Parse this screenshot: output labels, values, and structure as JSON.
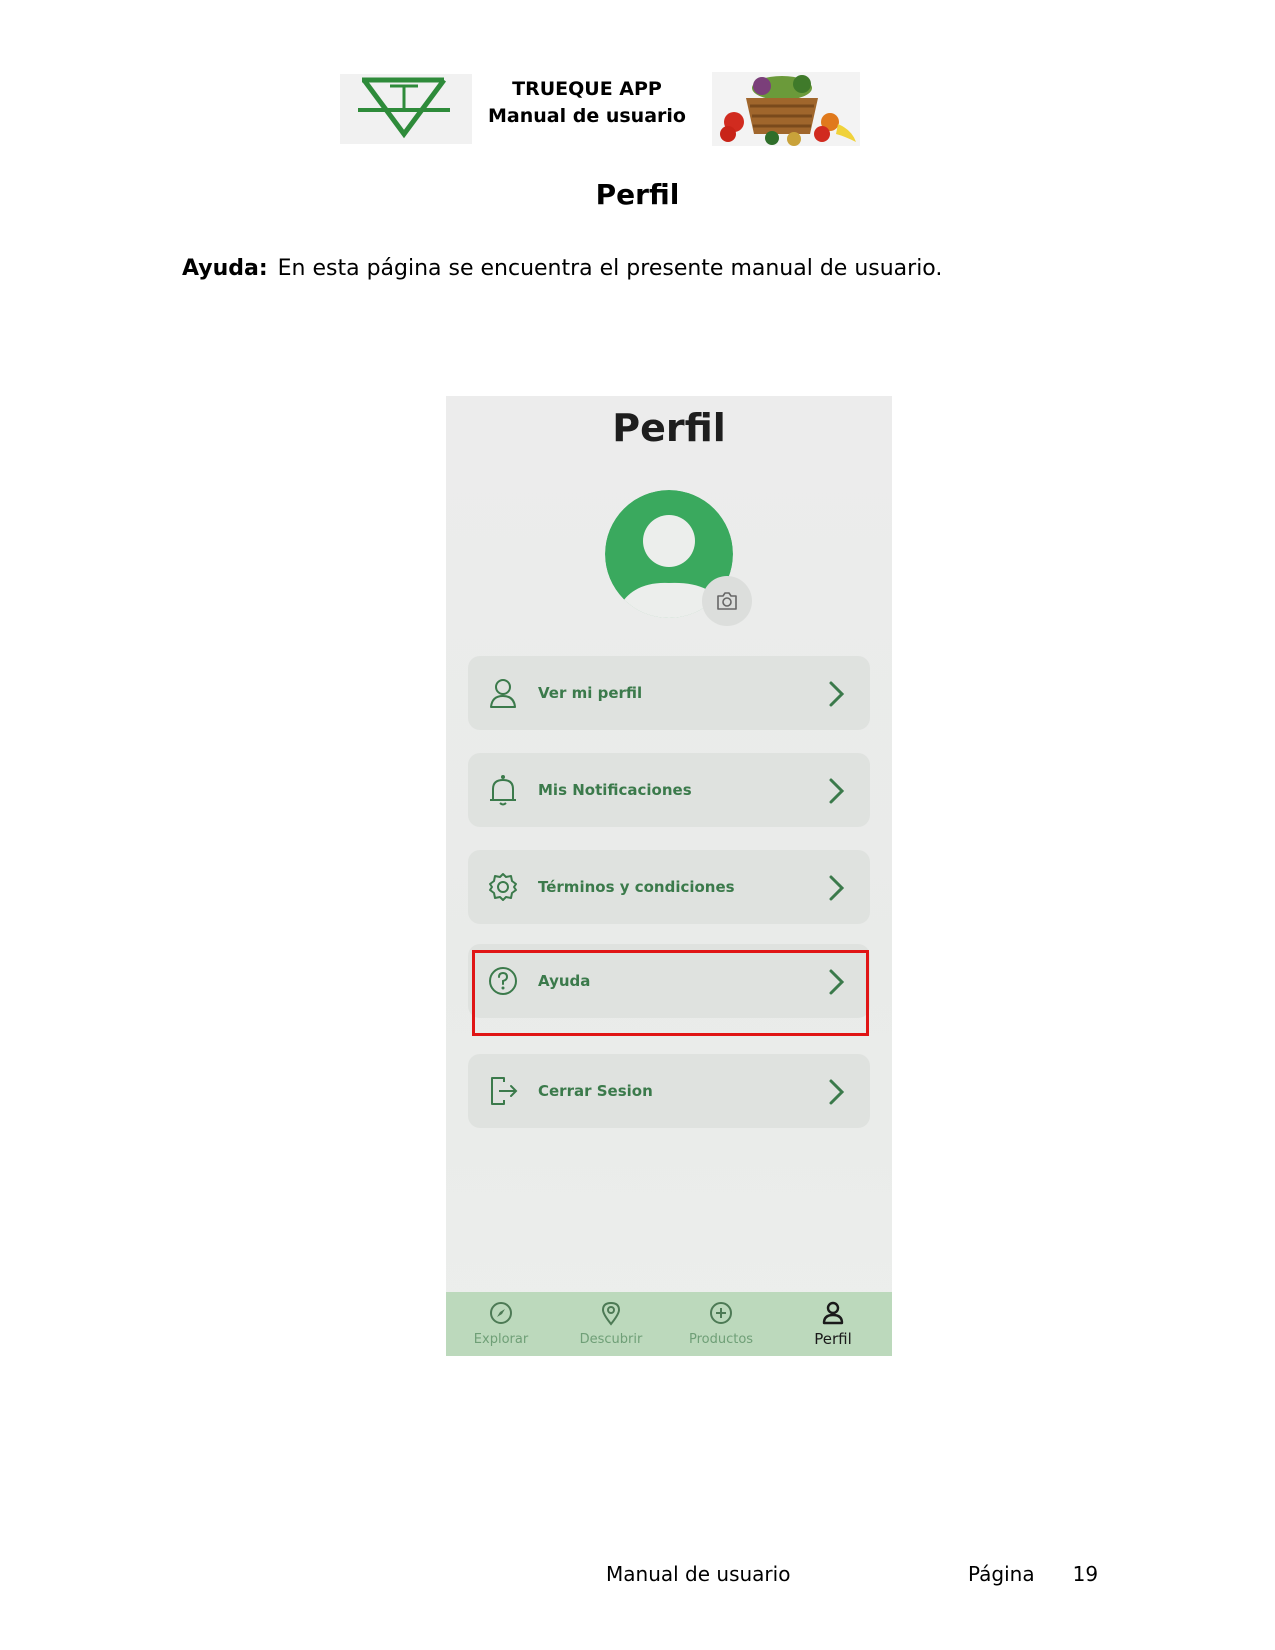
{
  "header": {
    "title_line1": "TRUEQUE APP",
    "title_line2": "Manual de usuario",
    "logo_icon": "trueque-logo-icon",
    "image_icon": "vegetable-basket-icon"
  },
  "doc": {
    "section_title": "Perfil",
    "paragraph_label": "Ayuda:",
    "paragraph_text": "En esta página se encuentra el presente manual de usuario."
  },
  "app": {
    "title": "Perfil",
    "menu": [
      {
        "label": "Ver mi perfil",
        "icon": "user-icon"
      },
      {
        "label": "Mis Notificaciones",
        "icon": "bell-icon"
      },
      {
        "label": "Términos y condiciones",
        "icon": "gear-icon"
      },
      {
        "label": "Ayuda",
        "icon": "help-icon"
      },
      {
        "label": "Cerrar Sesion",
        "icon": "logout-icon"
      }
    ],
    "nav": [
      {
        "label": "Explorar",
        "icon": "compass-icon"
      },
      {
        "label": "Descubrir",
        "icon": "location-pin-icon"
      },
      {
        "label": "Productos",
        "icon": "plus-circle-icon"
      },
      {
        "label": "Perfil",
        "icon": "user-icon"
      }
    ],
    "colors": {
      "brand_green": "#3aa95e",
      "label_green": "#3b7a4b",
      "nav_background": "#bcd9bc",
      "highlight_red": "#e01515"
    }
  },
  "footer": {
    "left": "Manual de usuario",
    "page_label": "Página",
    "page_number": "19"
  }
}
